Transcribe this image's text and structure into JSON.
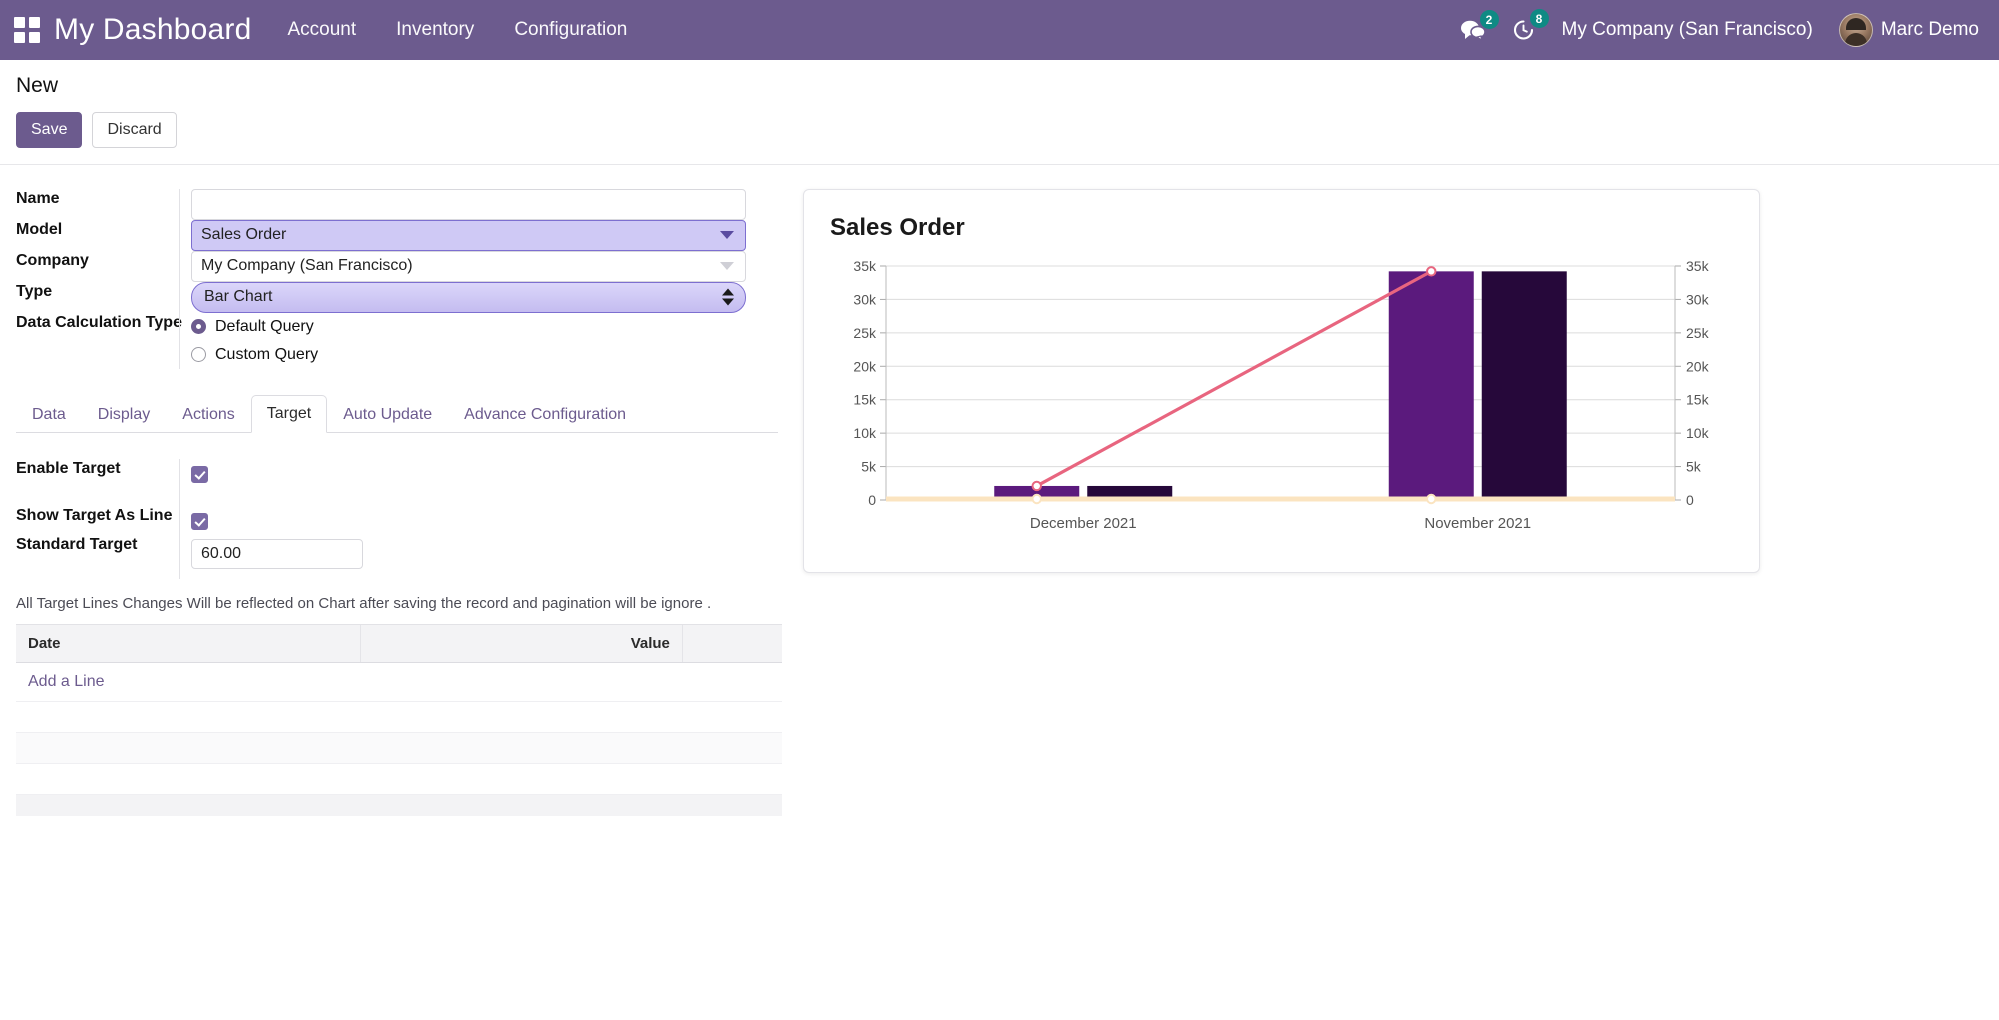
{
  "navbar": {
    "apps_icon": "apps-grid-icon",
    "brand": "My Dashboard",
    "menu": [
      "Account",
      "Inventory",
      "Configuration"
    ],
    "messages_icon": "chat-bubble-icon",
    "messages_count": "2",
    "activities_icon": "clock-icon",
    "activities_count": "8",
    "company": "My Company (San Francisco)",
    "user": "Marc Demo",
    "bg_color": "#6c5b8e"
  },
  "control_panel": {
    "title": "New",
    "save_label": "Save",
    "discard_label": "Discard"
  },
  "form": {
    "name": {
      "label": "Name",
      "value": "",
      "placeholder": ""
    },
    "model": {
      "label": "Model",
      "value": "Sales Order"
    },
    "company": {
      "label": "Company",
      "value": "My Company (San Francisco)"
    },
    "type": {
      "label": "Type",
      "value": "Bar Chart"
    },
    "data_calculation_type": {
      "label": "Data Calculation Type",
      "options": [
        "Default Query",
        "Custom Query"
      ],
      "selected": "Default Query"
    }
  },
  "tabs": {
    "items": [
      "Data",
      "Display",
      "Actions",
      "Target",
      "Auto Update",
      "Advance Configuration"
    ],
    "active": "Target"
  },
  "target_tab": {
    "enable_target": {
      "label": "Enable Target",
      "checked": true
    },
    "show_target_as_line": {
      "label": "Show Target As Line",
      "checked": true
    },
    "standard_target": {
      "label": "Standard Target",
      "value": "60.00"
    },
    "note": "All Target Lines Changes Will be reflected on Chart after saving the record and pagination will be ignore .",
    "table": {
      "columns": [
        "Date",
        "Value"
      ],
      "rows": [],
      "add_line_label": "Add a Line"
    }
  },
  "chart_data": {
    "type": "bar",
    "title": "Sales Order",
    "categories": [
      "December 2021",
      "November 2021"
    ],
    "series": [
      {
        "name": "series-1",
        "color": "#5b1a7d",
        "values": [
          2100,
          34200
        ]
      },
      {
        "name": "series-2",
        "color": "#26083a",
        "values": [
          2100,
          34200
        ]
      }
    ],
    "target_line": {
      "name": "Target",
      "color": "#e8657f",
      "values": [
        2100,
        34200
      ],
      "marker": "circle"
    },
    "baseline": {
      "name": "Standard Target",
      "color": "#fbe4c0",
      "value": 60
    },
    "ylabel": "",
    "xlabel": "",
    "ylim": [
      0,
      35000
    ],
    "yticks": [
      "0",
      "5k",
      "10k",
      "15k",
      "20k",
      "25k",
      "30k",
      "35k"
    ],
    "ytick_values": [
      0,
      5000,
      10000,
      15000,
      20000,
      25000,
      30000,
      35000
    ],
    "right_axis": true,
    "right_yticks": [
      "0",
      "5k",
      "10k",
      "15k",
      "20k",
      "25k",
      "30k",
      "35k"
    ],
    "grid": true,
    "legend": "none"
  }
}
